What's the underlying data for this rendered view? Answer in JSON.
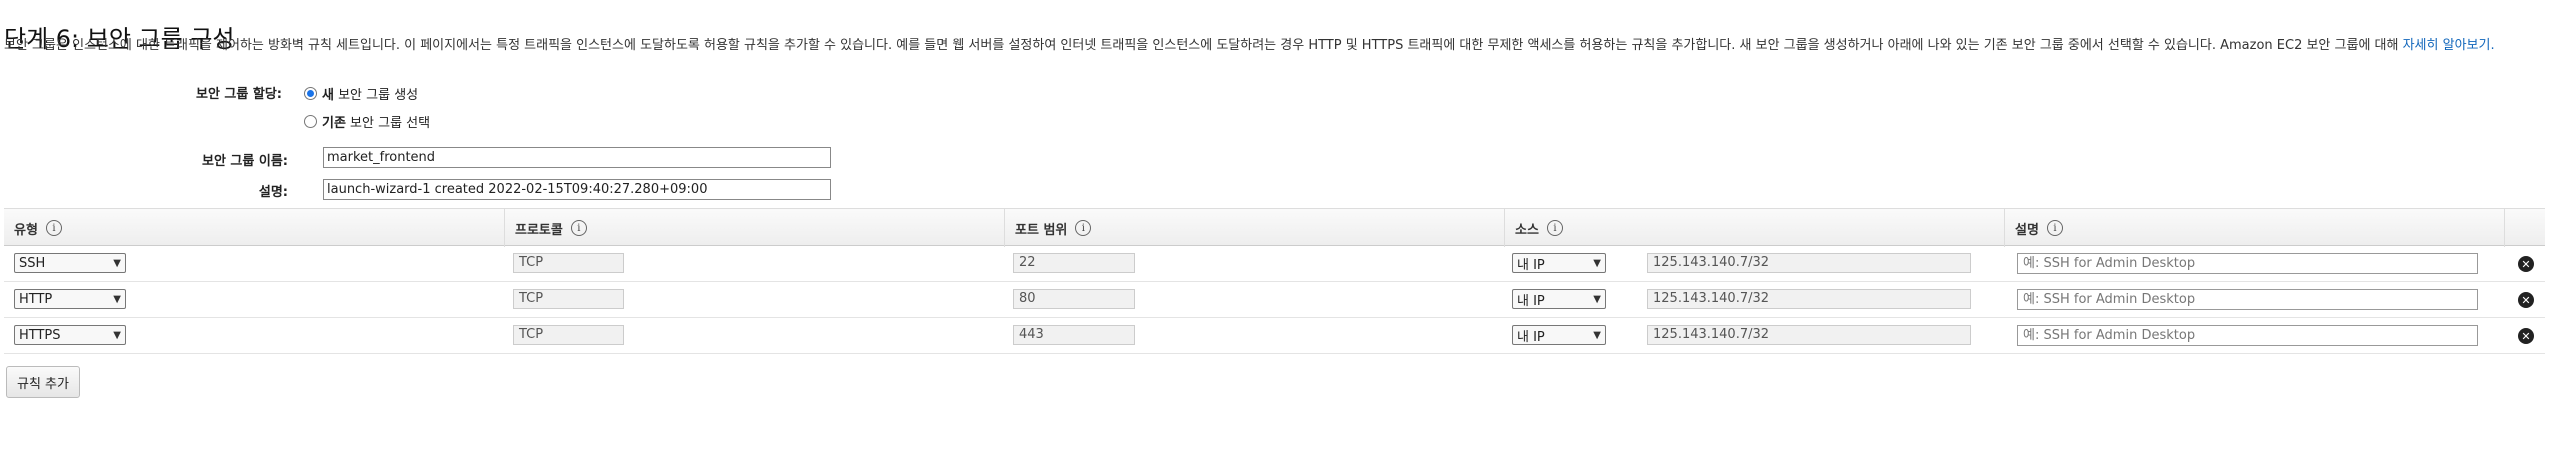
{
  "page": {
    "title": "단계 6: 보안 그룹 구성",
    "description": "보안 그룹은 인스턴스에 대한 트래픽을 제어하는 방화벽 규칙 세트입니다. 이 페이지에서는 특정 트래픽을 인스턴스에 도달하도록 허용할 규칙을 추가할 수 있습니다. 예를 들면 웹 서버를 설정하여 인터넷 트래픽을 인스턴스에 도달하려는 경우 HTTP 및 HTTPS 트래픽에 대한 무제한 액세스를 허용하는 규칙을 추가합니다. 새 보안 그룹을 생성하거나 아래에 나와 있는 기존 보안 그룹 중에서 선택할 수 있습니다. Amazon EC2 보안 그룹에 대해 ",
    "learn_more": "자세히 알아보기."
  },
  "form": {
    "assign_label": "보안 그룹 할당:",
    "option_new_bold": "새",
    "option_new_rest": " 보안 그룹 생성",
    "option_existing_bold": "기존",
    "option_existing_rest": " 보안 그룹 선택",
    "name_label": "보안 그룹 이름:",
    "name_value": "market_frontend",
    "desc_label": "설명:",
    "desc_value": "launch-wizard-1 created 2022-02-15T09:40:27.280+09:00"
  },
  "table": {
    "headers": {
      "type": "유형",
      "protocol": "프로토콜",
      "port_range": "포트 범위",
      "source": "소스",
      "description": "설명"
    },
    "rows": [
      {
        "type": "SSH",
        "protocol": "TCP",
        "port": "22",
        "source": "내 IP",
        "cidr": "125.143.140.7/32",
        "desc_placeholder": "예: SSH for Admin Desktop"
      },
      {
        "type": "HTTP",
        "protocol": "TCP",
        "port": "80",
        "source": "내 IP",
        "cidr": "125.143.140.7/32",
        "desc_placeholder": "예: SSH for Admin Desktop"
      },
      {
        "type": "HTTPS",
        "protocol": "TCP",
        "port": "443",
        "source": "내 IP",
        "cidr": "125.143.140.7/32",
        "desc_placeholder": "예: SSH for Admin Desktop"
      }
    ]
  },
  "actions": {
    "add_rule": "규칙 추가"
  },
  "icons": {
    "info": "info-icon",
    "delete": "delete-rule-icon",
    "dropdown": "chevron-down-icon"
  },
  "colors": {
    "link": "#1166bb",
    "radio_selected": "#1a73e8"
  }
}
